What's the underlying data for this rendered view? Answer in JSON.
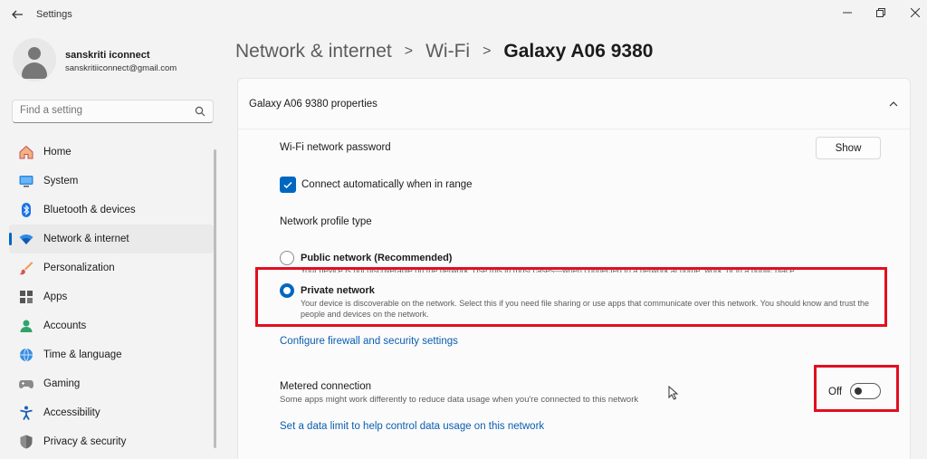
{
  "window": {
    "title": "Settings",
    "back_icon": "back-arrow-icon",
    "minimize_icon": "minimize-icon",
    "maximize_icon": "restore-icon",
    "close_icon": "close-icon"
  },
  "profile": {
    "name": "sanskriti iconnect",
    "email": "sanskritiiconnect@gmail.com"
  },
  "search": {
    "placeholder": "Find a setting",
    "icon": "search-icon"
  },
  "sidebar": {
    "items": [
      {
        "label": "Home",
        "icon": "home-icon",
        "active": false
      },
      {
        "label": "System",
        "icon": "system-icon",
        "active": false
      },
      {
        "label": "Bluetooth & devices",
        "icon": "bluetooth-icon",
        "active": false
      },
      {
        "label": "Network & internet",
        "icon": "wifi-icon",
        "active": true
      },
      {
        "label": "Personalization",
        "icon": "brush-icon",
        "active": false
      },
      {
        "label": "Apps",
        "icon": "apps-icon",
        "active": false
      },
      {
        "label": "Accounts",
        "icon": "accounts-icon",
        "active": false
      },
      {
        "label": "Time & language",
        "icon": "globe-icon",
        "active": false
      },
      {
        "label": "Gaming",
        "icon": "gamepad-icon",
        "active": false
      },
      {
        "label": "Accessibility",
        "icon": "accessibility-icon",
        "active": false
      },
      {
        "label": "Privacy & security",
        "icon": "shield-icon",
        "active": false
      }
    ]
  },
  "breadcrumb": {
    "items": [
      "Network & internet",
      "Wi-Fi"
    ],
    "current": "Galaxy A06 9380",
    "separator": ">"
  },
  "properties": {
    "title": "Galaxy A06 9380 properties",
    "password_label": "Wi-Fi network password",
    "show_button": "Show",
    "auto_connect_label": "Connect automatically when in range",
    "auto_connect_checked": true,
    "profile_type_label": "Network profile type",
    "public": {
      "title": "Public network (Recommended)",
      "desc": "Your device is not discoverable on the network. Use this in most cases—when connected to a network at home, work, or in a public place.",
      "selected": false
    },
    "private": {
      "title": "Private network",
      "desc": "Your device is discoverable on the network. Select this if you need file sharing or use apps that communicate over this network. You should know and trust the people and devices on the network.",
      "selected": true
    },
    "firewall_link": "Configure firewall and security settings",
    "metered": {
      "title": "Metered connection",
      "desc": "Some apps might work differently to reduce data usage when you're connected to this network",
      "state_label": "Off",
      "on": false
    },
    "data_limit_link": "Set a data limit to help control data usage on this network"
  },
  "colors": {
    "accent": "#0067c0",
    "highlight": "#e10f1f",
    "link": "#0a5eb0"
  }
}
